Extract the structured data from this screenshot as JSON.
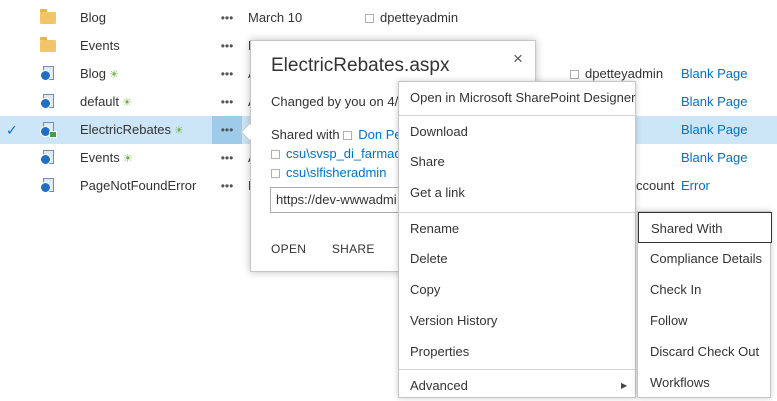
{
  "files": [
    {
      "name": "Blog",
      "type": "folder",
      "new": false,
      "selected": false,
      "modified": "March 10",
      "modified_by": "dpetteyadmin",
      "content_type": ""
    },
    {
      "name": "Events",
      "type": "folder",
      "new": false,
      "selected": false,
      "modified": "M",
      "modified_by": "",
      "content_type": ""
    },
    {
      "name": "Blog",
      "type": "page",
      "new": true,
      "selected": false,
      "modified": "A",
      "modified_by": "dpetteyadmin",
      "content_type": "Blank Page"
    },
    {
      "name": "default",
      "type": "page",
      "new": true,
      "selected": false,
      "modified": "A",
      "modified_by": "dmin",
      "content_type": "Blank Page"
    },
    {
      "name": "ElectricRebates",
      "type": "page-locked",
      "new": true,
      "selected": true,
      "modified": "",
      "modified_by": "dmin",
      "content_type": "Blank Page"
    },
    {
      "name": "Events",
      "type": "page",
      "new": true,
      "selected": false,
      "modified": "A",
      "modified_by": "dmin",
      "content_type": "Blank Page"
    },
    {
      "name": "PageNotFoundError",
      "type": "page",
      "new": false,
      "selected": false,
      "modified": "M",
      "modified_by": "ccount",
      "content_type": "Error"
    }
  ],
  "row_menu_label": "•••",
  "new_marker": "☀",
  "callout": {
    "title": "ElectricRebates.aspx",
    "close": "×",
    "changed": "Changed by you on 4/2",
    "shared_prefix": "Shared with",
    "shared_users": [
      "Don Pett",
      "csu\\svsp_di_farmadm",
      "csu\\slfisheradmin"
    ],
    "url": "https://dev-wwwadmi",
    "actions": {
      "open": "OPEN",
      "share": "SHARE",
      "more": "•••"
    }
  },
  "context_menu": {
    "items": [
      "Open in Microsoft SharePoint Designer",
      "Download",
      "Share",
      "Get a link",
      "Rename",
      "Delete",
      "Copy",
      "Version History",
      "Properties",
      "Advanced"
    ]
  },
  "submenu": {
    "items": [
      "Shared With",
      "Compliance Details",
      "Check In",
      "Follow",
      "Discard Check Out",
      "Workflows"
    ],
    "highlighted": "Shared With"
  },
  "colors": {
    "link": "#0072c6",
    "selected_row": "#cde6f7",
    "new_marker": "#6cb33f"
  }
}
